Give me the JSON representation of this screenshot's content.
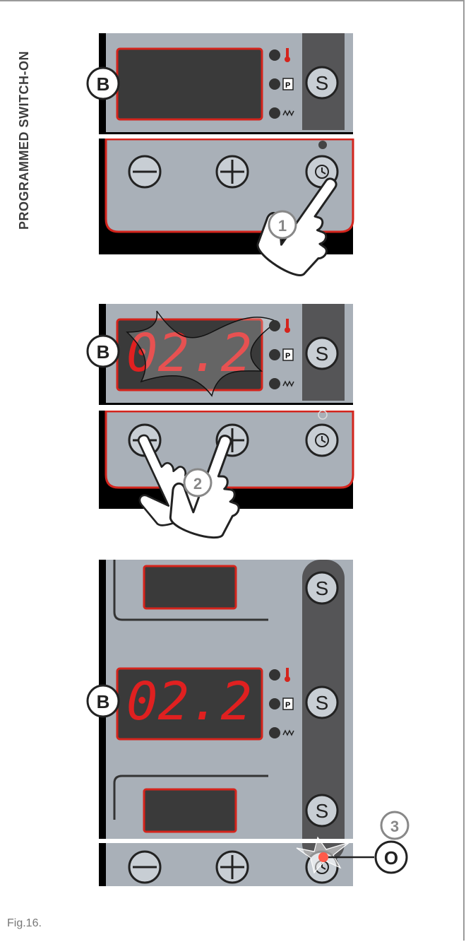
{
  "side_title": "PROGRAMMED SWITCH-ON",
  "caption": "Fig.16.",
  "callouts": {
    "display_label": "B",
    "indicator_label": "O",
    "step1": "1",
    "step2": "2",
    "step3": "3"
  },
  "panel": {
    "select_button_label": "S",
    "display_value": "02.2",
    "indicator_icons": [
      "thermometer-icon",
      "program-icon",
      "heating-icon"
    ]
  },
  "colors": {
    "panel": "#a9b0b8",
    "display_bg": "#3a3a3a",
    "display_border": "#d4241c",
    "digits": "#e02020",
    "led_active": "#ff5a4a",
    "strip": "#555557"
  }
}
